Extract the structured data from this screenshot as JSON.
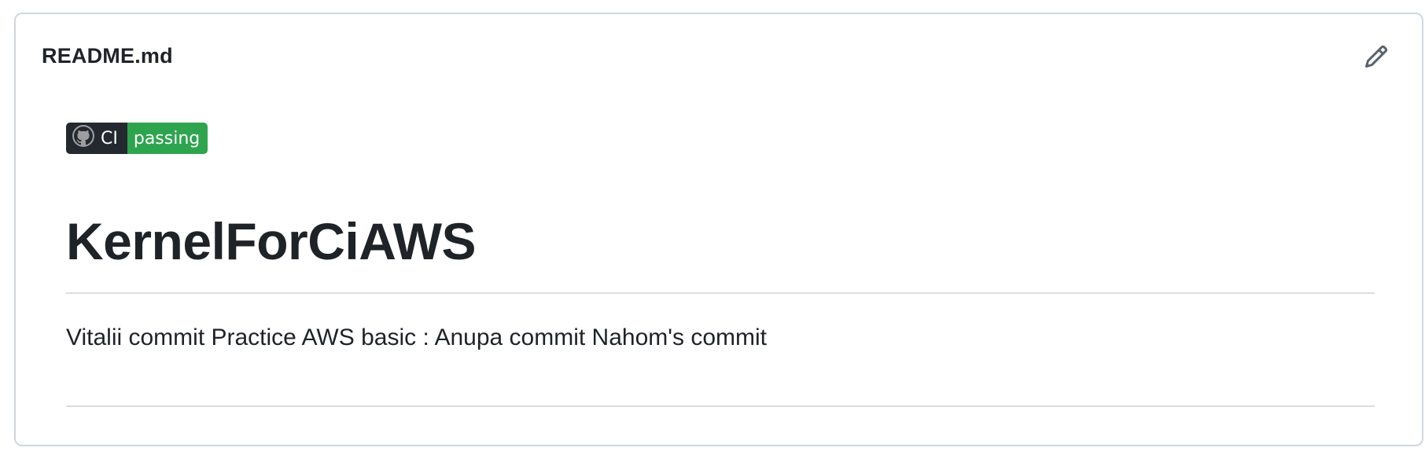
{
  "readme": {
    "file_name": "README.md",
    "edit_icon": "pencil-icon"
  },
  "badge": {
    "icon": "github-logo-icon",
    "label": "CI",
    "status": "passing",
    "label_color": "#24292f",
    "status_color": "#2ea44f"
  },
  "content": {
    "title": "KernelForCiAWS",
    "description": "Vitalii commit Practice AWS basic : Anupa commit Nahom's commit"
  },
  "colors": {
    "border": "#d0d7de",
    "text": "#1f2328",
    "rule": "#d8dee4"
  }
}
